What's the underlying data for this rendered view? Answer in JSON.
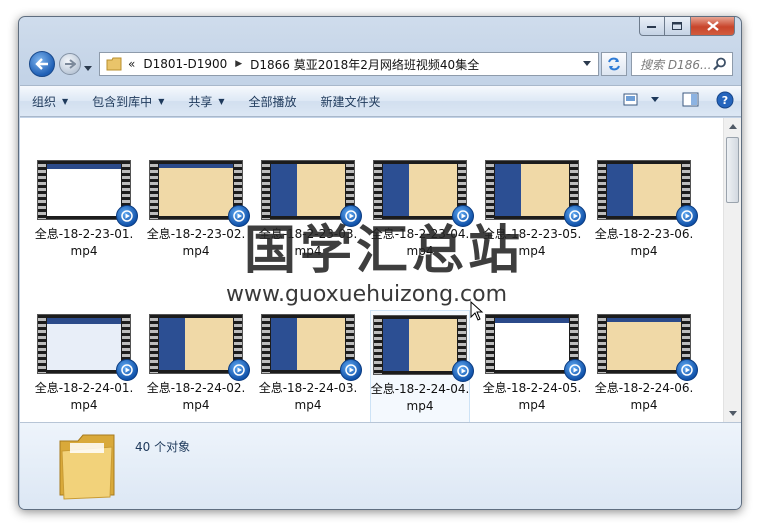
{
  "address": {
    "back_chevron": "«",
    "crumbs": [
      "D1801-D1900",
      "D1866 莫亚2018年2月网络班视频40集全"
    ]
  },
  "search": {
    "placeholder": "搜索 D186..."
  },
  "toolbar": {
    "items": [
      {
        "label": "组织",
        "dropdown": true
      },
      {
        "label": "包含到库中",
        "dropdown": true
      },
      {
        "label": "共享",
        "dropdown": true
      },
      {
        "label": "全部播放",
        "dropdown": false
      },
      {
        "label": "新建文件夹",
        "dropdown": false
      }
    ]
  },
  "files": [
    {
      "name": "全息-18-2-23-01.mp4",
      "thumb": "white",
      "selected": false
    },
    {
      "name": "全息-18-2-23-02.mp4",
      "thumb": "paper",
      "selected": false
    },
    {
      "name": "全息-18-2-23-03.mp4",
      "thumb": "mixed",
      "selected": false
    },
    {
      "name": "全息-18-2-23-04.mp4",
      "thumb": "mixed",
      "selected": false
    },
    {
      "name": "全息-18-2-23-05.mp4",
      "thumb": "mixed",
      "selected": false
    },
    {
      "name": "全息-18-2-23-06.mp4",
      "thumb": "mixed",
      "selected": false
    },
    {
      "name": "全息-18-2-24-01.mp4",
      "thumb": "blue",
      "selected": false
    },
    {
      "name": "全息-18-2-24-02.mp4",
      "thumb": "mixed",
      "selected": false
    },
    {
      "name": "全息-18-2-24-03.mp4",
      "thumb": "mixed",
      "selected": false
    },
    {
      "name": "全息-18-2-24-04.mp4",
      "thumb": "mixed",
      "selected": true
    },
    {
      "name": "全息-18-2-24-05.mp4",
      "thumb": "white",
      "selected": false
    },
    {
      "name": "全息-18-2-24-06.mp4",
      "thumb": "paper",
      "selected": false
    }
  ],
  "watermark": {
    "title": "国学汇总站",
    "url": "www.guoxuehuizong.com"
  },
  "details": {
    "count": "40 个对象"
  },
  "colors": {
    "accent": "#1e395b",
    "selection": "#cde3f6",
    "close_button": "#c8452b"
  }
}
